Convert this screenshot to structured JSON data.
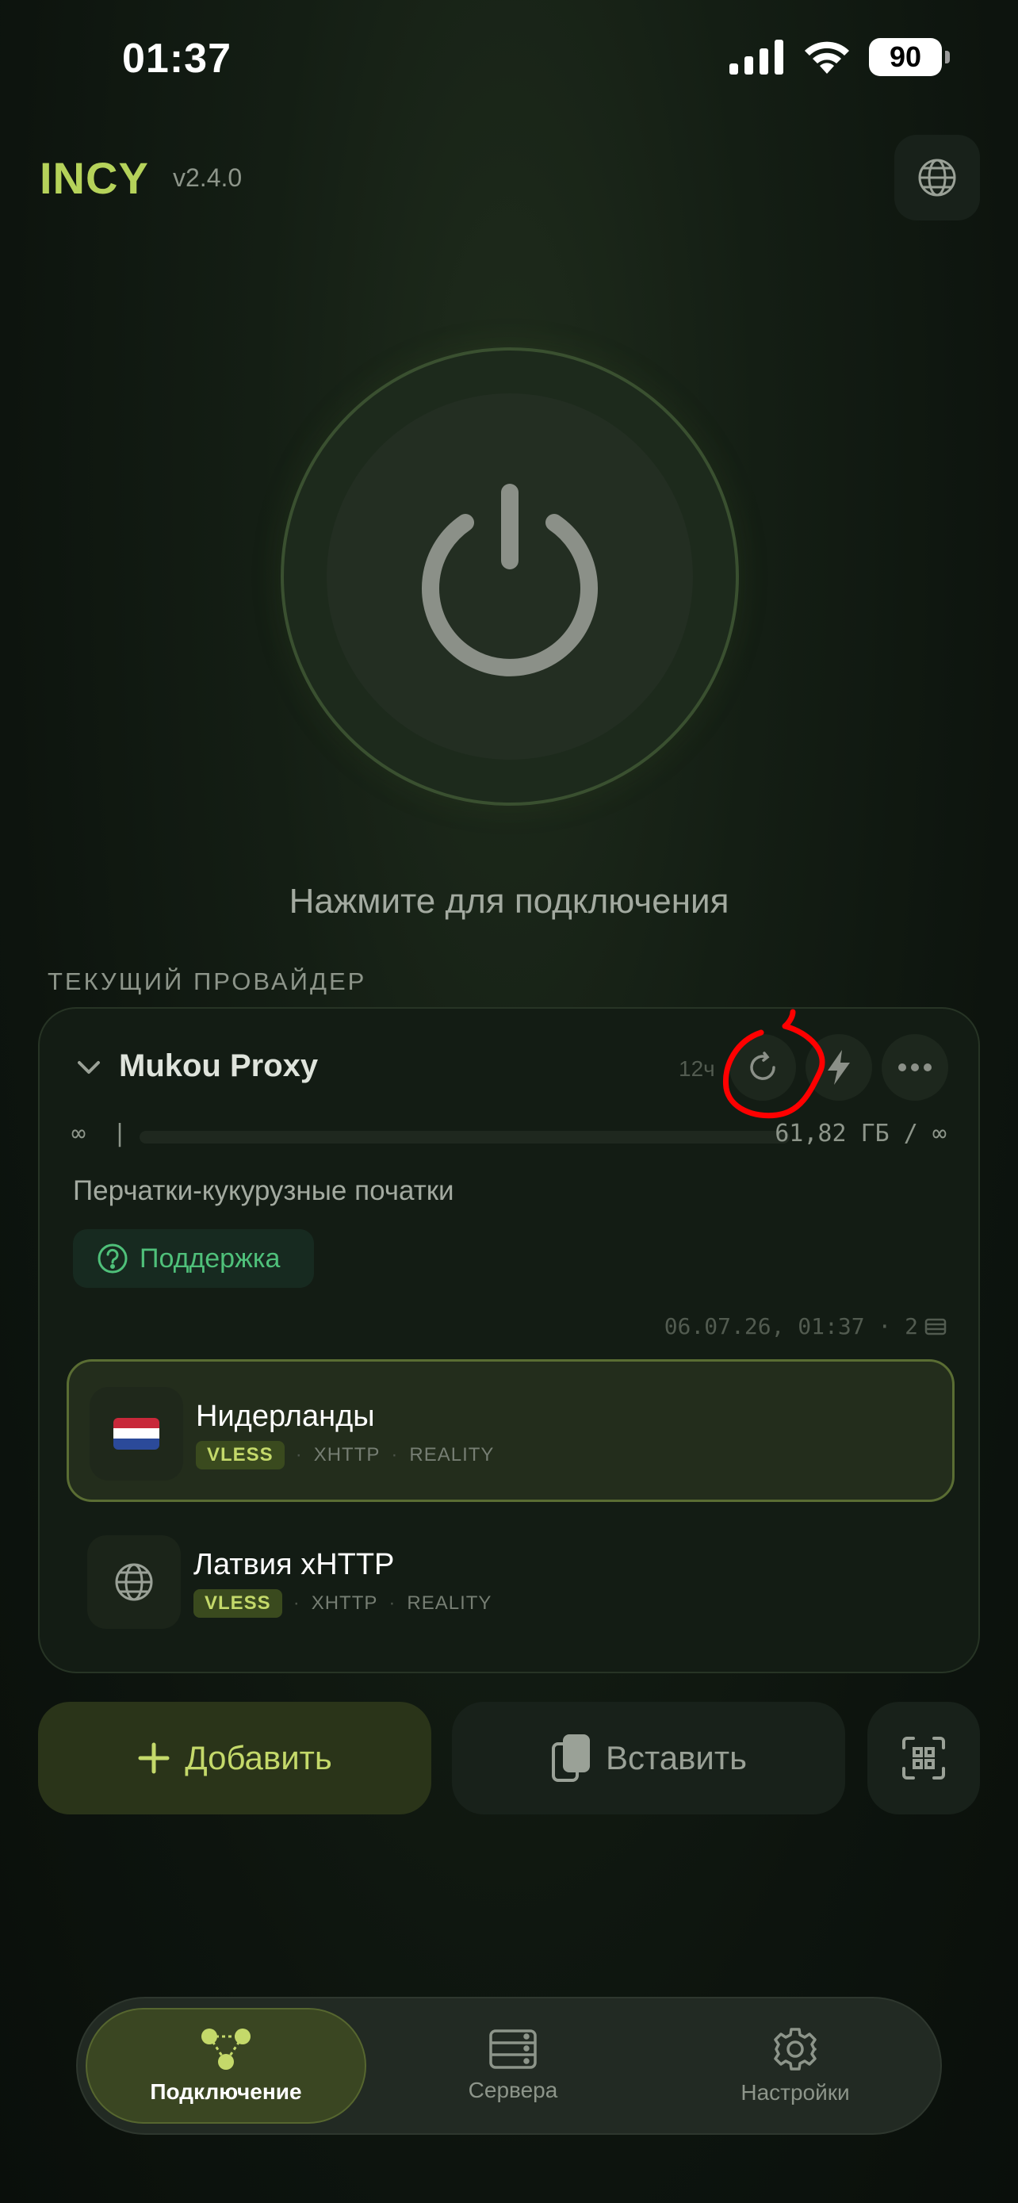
{
  "status_bar": {
    "time": "01:37",
    "battery": "90"
  },
  "header": {
    "brand": "INCY",
    "version": "v2.4.0",
    "language_icon": "globe-icon"
  },
  "power": {
    "hint": "Нажмите для подключения"
  },
  "provider_section": {
    "label": "ТЕКУЩИЙ ПРОВАЙДЕР"
  },
  "provider": {
    "name": "Mukou Proxy",
    "time_badge": "12ч",
    "traffic_left": "∞",
    "traffic_sep": "|",
    "traffic": "61,82 ГБ / ∞",
    "description": "Перчатки-кукурузные початки",
    "support_label": "Поддержка",
    "updated": "06.07.26, 01:37 · 2"
  },
  "servers": [
    {
      "flag": "🇳🇱",
      "name": "Нидерланды",
      "protocol": "VLESS",
      "transport": "XHTTP",
      "security": "REALITY",
      "active": true
    },
    {
      "flag": "globe",
      "name": "Латвия xHTTP",
      "protocol": "VLESS",
      "transport": "XHTTP",
      "security": "REALITY",
      "active": false
    }
  ],
  "actions": {
    "add": "Добавить",
    "paste": "Вставить"
  },
  "nav": {
    "connection": "Подключение",
    "servers": "Сервера",
    "settings": "Настройки"
  },
  "colors": {
    "accent": "#b5d25a",
    "support": "#4fc07a",
    "annotation": "#ff0000"
  }
}
